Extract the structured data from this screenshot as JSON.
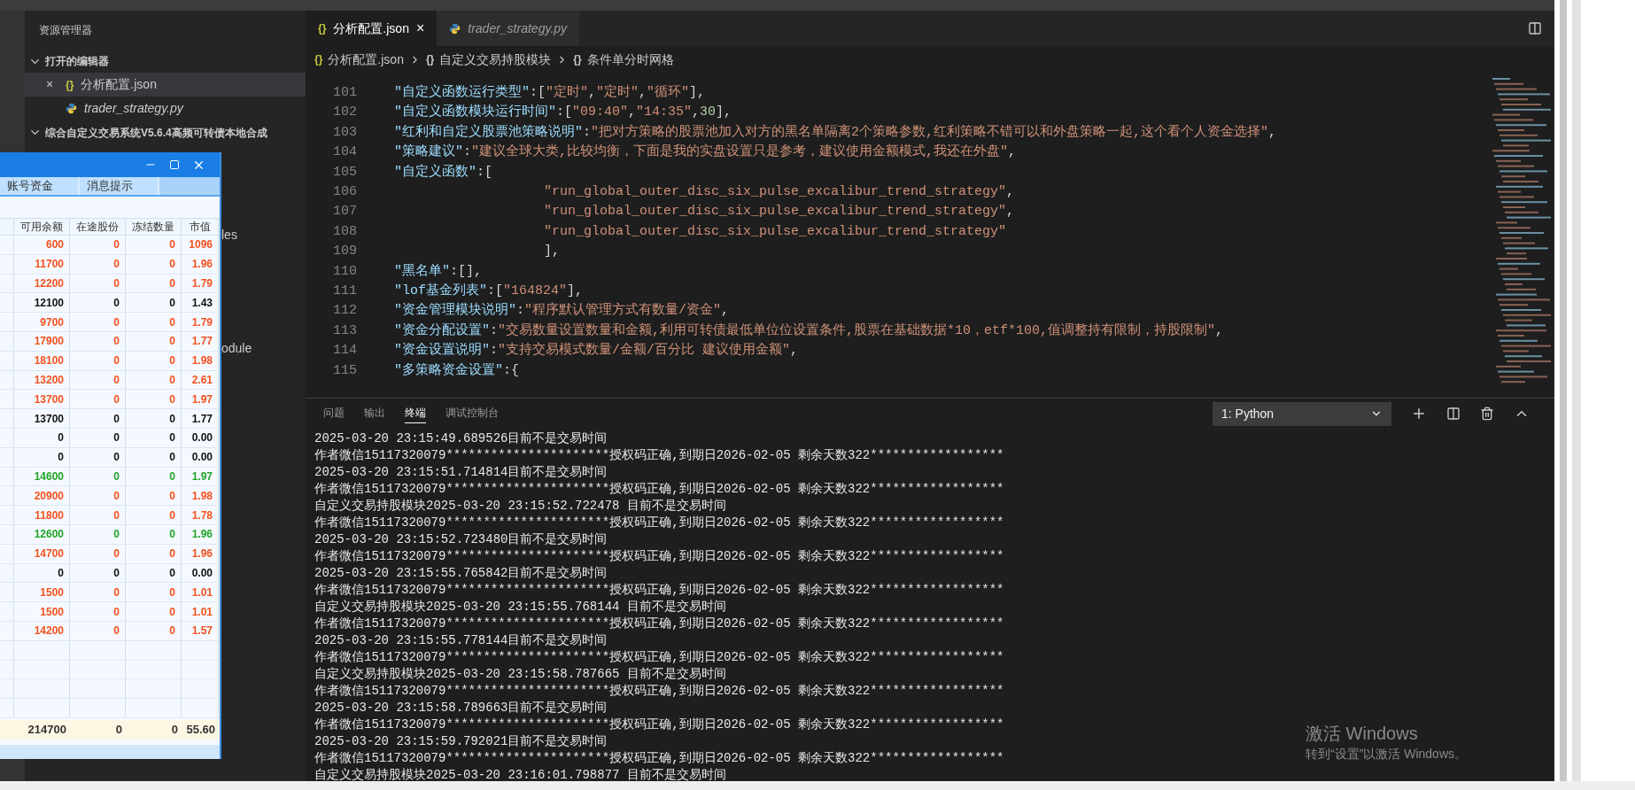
{
  "explorer": {
    "title": "资源管理器",
    "open_editors": {
      "label": "打开的编辑器",
      "expanded": true,
      "items": [
        {
          "name": "分析配置.json",
          "kind": "json",
          "icon_text": "{}",
          "close": "×",
          "selected": true
        },
        {
          "name": "trader_strategy.py",
          "kind": "python",
          "selected": false
        }
      ]
    },
    "project": {
      "label": "综合自定义交易系统V5.6.4高频可转债本地合成",
      "expanded": true,
      "visible_items": [
        "les",
        "odule"
      ]
    }
  },
  "editor": {
    "tabs": [
      {
        "label": "分析配置.json",
        "kind": "json",
        "icon_text": "{}",
        "close": "×",
        "selected": true
      },
      {
        "label": "trader_strategy.py",
        "kind": "python",
        "selected": false
      }
    ],
    "breadcrumb": [
      {
        "icon_text": "{}",
        "label": "分析配置.json"
      },
      {
        "icon_text": "{}",
        "label": "自定义交易持股模块"
      },
      {
        "icon_text": "{}",
        "label": "条件单分时网格"
      }
    ],
    "lines": [
      {
        "number": "101",
        "deep": false,
        "tokens": [
          {
            "kind": "key",
            "text": "\"自定义函数运行类型\""
          },
          {
            "kind": "punct",
            "text": ":["
          },
          {
            "kind": "str",
            "text": "\"定时\""
          },
          {
            "kind": "punct",
            "text": ","
          },
          {
            "kind": "str",
            "text": "\"定时\""
          },
          {
            "kind": "punct",
            "text": ","
          },
          {
            "kind": "str",
            "text": "\"循环\""
          },
          {
            "kind": "punct",
            "text": "],"
          }
        ]
      },
      {
        "number": "102",
        "deep": false,
        "tokens": [
          {
            "kind": "key",
            "text": "\"自定义函数模块运行时间\""
          },
          {
            "kind": "punct",
            "text": ":["
          },
          {
            "kind": "str",
            "text": "\"09:40\""
          },
          {
            "kind": "punct",
            "text": ","
          },
          {
            "kind": "str",
            "text": "\"14:35\""
          },
          {
            "kind": "punct",
            "text": ","
          },
          {
            "kind": "num",
            "text": "30"
          },
          {
            "kind": "punct",
            "text": "],"
          }
        ]
      },
      {
        "number": "103",
        "deep": false,
        "tokens": [
          {
            "kind": "key",
            "text": "\"红利和自定义股票池策略说明\""
          },
          {
            "kind": "punct",
            "text": ":"
          },
          {
            "kind": "str",
            "text": "\"把对方策略的股票池加入对方的黑名单隔离2个策略参数,红利策略不错可以和外盘策略一起,这个看个人资金选择\""
          },
          {
            "kind": "punct",
            "text": ","
          }
        ]
      },
      {
        "number": "104",
        "deep": false,
        "tokens": [
          {
            "kind": "key",
            "text": "\"策略建议\""
          },
          {
            "kind": "punct",
            "text": ":"
          },
          {
            "kind": "str",
            "text": "\"建议全球大类,比较均衡，下面是我的实盘设置只是参考，建议使用金额模式,我还在外盘\""
          },
          {
            "kind": "punct",
            "text": ","
          }
        ]
      },
      {
        "number": "105",
        "deep": false,
        "tokens": [
          {
            "kind": "key",
            "text": "\"自定义函数\""
          },
          {
            "kind": "punct",
            "text": ":["
          }
        ]
      },
      {
        "number": "106",
        "deep": true,
        "tokens": [
          {
            "kind": "str",
            "text": "\"run_global_outer_disc_six_pulse_excalibur_trend_strategy\""
          },
          {
            "kind": "punct",
            "text": ","
          }
        ]
      },
      {
        "number": "107",
        "deep": true,
        "tokens": [
          {
            "kind": "str",
            "text": "\"run_global_outer_disc_six_pulse_excalibur_trend_strategy\""
          },
          {
            "kind": "punct",
            "text": ","
          }
        ]
      },
      {
        "number": "108",
        "deep": true,
        "tokens": [
          {
            "kind": "str",
            "text": "\"run_global_outer_disc_six_pulse_excalibur_trend_strategy\""
          }
        ]
      },
      {
        "number": "109",
        "deep": true,
        "tokens": [
          {
            "kind": "punct",
            "text": "],"
          }
        ]
      },
      {
        "number": "110",
        "deep": false,
        "tokens": [
          {
            "kind": "key",
            "text": "\"黑名单\""
          },
          {
            "kind": "punct",
            "text": ":[],"
          }
        ]
      },
      {
        "number": "111",
        "deep": false,
        "tokens": [
          {
            "kind": "key",
            "text": "\"lof基金列表\""
          },
          {
            "kind": "punct",
            "text": ":["
          },
          {
            "kind": "str",
            "text": "\"164824\""
          },
          {
            "kind": "punct",
            "text": "],"
          }
        ]
      },
      {
        "number": "112",
        "deep": false,
        "tokens": [
          {
            "kind": "key",
            "text": "\"资金管理模块说明\""
          },
          {
            "kind": "punct",
            "text": ":"
          },
          {
            "kind": "str",
            "text": "\"程序默认管理方式有数量/资金\""
          },
          {
            "kind": "punct",
            "text": ","
          }
        ]
      },
      {
        "number": "113",
        "deep": false,
        "tokens": [
          {
            "kind": "key",
            "text": "\"资金分配设置\""
          },
          {
            "kind": "punct",
            "text": ":"
          },
          {
            "kind": "str",
            "text": "\"交易数量设置数量和金额,利用可转债最低单位位设置条件,股票在基础数据*10，etf*100,值调整持有限制，持股限制\""
          },
          {
            "kind": "punct",
            "text": ","
          }
        ]
      },
      {
        "number": "114",
        "deep": false,
        "tokens": [
          {
            "kind": "key",
            "text": "\"资金设置说明\""
          },
          {
            "kind": "punct",
            "text": ":"
          },
          {
            "kind": "str",
            "text": "\"支持交易模式数量/金额/百分比 建议使用金额\""
          },
          {
            "kind": "punct",
            "text": ","
          }
        ]
      },
      {
        "number": "115",
        "deep": false,
        "tokens": [
          {
            "kind": "key",
            "text": "\"多策略资金设置\""
          },
          {
            "kind": "punct",
            "text": ":{"
          }
        ]
      }
    ]
  },
  "panel": {
    "tabs": [
      {
        "label": "问题",
        "selected": false
      },
      {
        "label": "输出",
        "selected": false
      },
      {
        "label": "终端",
        "selected": true
      },
      {
        "label": "调试控制台",
        "selected": false
      }
    ],
    "terminal_select": "1: Python",
    "terminal_lines": [
      "2025-03-20 23:15:49.689526目前不是交易时间",
      "作者微信15117320079**********************授权码正确,到期日2026-02-05 剩余天数322******************",
      "2025-03-20 23:15:51.714814目前不是交易时间",
      "作者微信15117320079**********************授权码正确,到期日2026-02-05 剩余天数322******************",
      "自定义交易持股模块2025-03-20 23:15:52.722478 目前不是交易时间",
      "作者微信15117320079**********************授权码正确,到期日2026-02-05 剩余天数322******************",
      "2025-03-20 23:15:52.723480目前不是交易时间",
      "作者微信15117320079**********************授权码正确,到期日2026-02-05 剩余天数322******************",
      "2025-03-20 23:15:55.765842目前不是交易时间",
      "作者微信15117320079**********************授权码正确,到期日2026-02-05 剩余天数322******************",
      "自定义交易持股模块2025-03-20 23:15:55.768144 目前不是交易时间",
      "作者微信15117320079**********************授权码正确,到期日2026-02-05 剩余天数322******************",
      "2025-03-20 23:15:55.778144目前不是交易时间",
      "作者微信15117320079**********************授权码正确,到期日2026-02-05 剩余天数322******************",
      "自定义交易持股模块2025-03-20 23:15:58.787665 目前不是交易时间",
      "作者微信15117320079**********************授权码正确,到期日2026-02-05 剩余天数322******************",
      "2025-03-20 23:15:58.789663目前不是交易时间",
      "作者微信15117320079**********************授权码正确,到期日2026-02-05 剩余天数322******************",
      "2025-03-20 23:15:59.792021目前不是交易时间",
      "作者微信15117320079**********************授权码正确,到期日2026-02-05 剩余天数322******************",
      "自定义交易持股模块2025-03-20 23:16:01.798877 目前不是交易时间"
    ]
  },
  "trade_window": {
    "tabs": [
      {
        "label": "账号资金",
        "selected": false
      },
      {
        "label": "消息提示",
        "selected": false
      }
    ],
    "columns": [
      "可用余额",
      "在途股份",
      "冻结数量",
      "市值"
    ],
    "rows": [
      {
        "cells": [
          "600",
          "0",
          "0",
          "1096"
        ],
        "color": "#f4511e"
      },
      {
        "cells": [
          "11700",
          "0",
          "0",
          "1.96"
        ],
        "color": "#f4511e"
      },
      {
        "cells": [
          "12200",
          "0",
          "0",
          "1.79"
        ],
        "color": "#f4511e"
      },
      {
        "cells": [
          "12100",
          "0",
          "0",
          "1.43"
        ],
        "color": "#111111"
      },
      {
        "cells": [
          "9700",
          "0",
          "0",
          "1.79"
        ],
        "color": "#f4511e"
      },
      {
        "cells": [
          "17900",
          "0",
          "0",
          "1.77"
        ],
        "color": "#f4511e"
      },
      {
        "cells": [
          "18100",
          "0",
          "0",
          "1.98"
        ],
        "color": "#f4511e"
      },
      {
        "cells": [
          "13200",
          "0",
          "0",
          "2.61"
        ],
        "color": "#f4511e"
      },
      {
        "cells": [
          "13700",
          "0",
          "0",
          "1.97"
        ],
        "color": "#f4511e"
      },
      {
        "cells": [
          "13700",
          "0",
          "0",
          "1.77"
        ],
        "color": "#111111"
      },
      {
        "cells": [
          "0",
          "0",
          "0",
          "0.00"
        ],
        "color": "#111111"
      },
      {
        "cells": [
          "0",
          "0",
          "0",
          "0.00"
        ],
        "color": "#111111"
      },
      {
        "cells": [
          "14600",
          "0",
          "0",
          "1.97"
        ],
        "color": "#22a52a"
      },
      {
        "cells": [
          "20900",
          "0",
          "0",
          "1.98"
        ],
        "color": "#f4511e"
      },
      {
        "cells": [
          "11800",
          "0",
          "0",
          "1.78"
        ],
        "color": "#f4511e"
      },
      {
        "cells": [
          "12600",
          "0",
          "0",
          "1.96"
        ],
        "color": "#22a52a"
      },
      {
        "cells": [
          "14700",
          "0",
          "0",
          "1.96"
        ],
        "color": "#f4511e"
      },
      {
        "cells": [
          "0",
          "0",
          "0",
          "0.00"
        ],
        "color": "#111111"
      },
      {
        "cells": [
          "1500",
          "0",
          "0",
          "1.01"
        ],
        "color": "#f4511e"
      },
      {
        "cells": [
          "1500",
          "0",
          "0",
          "1.01"
        ],
        "color": "#f4511e"
      },
      {
        "cells": [
          "14200",
          "0",
          "0",
          "1.57"
        ],
        "color": "#f4511e"
      }
    ],
    "total": [
      "214700",
      "0",
      "0",
      "55.60"
    ]
  },
  "activation_notice": {
    "title": "激活 Windows",
    "subtitle": "转到“设置”以激活 Windows。"
  }
}
